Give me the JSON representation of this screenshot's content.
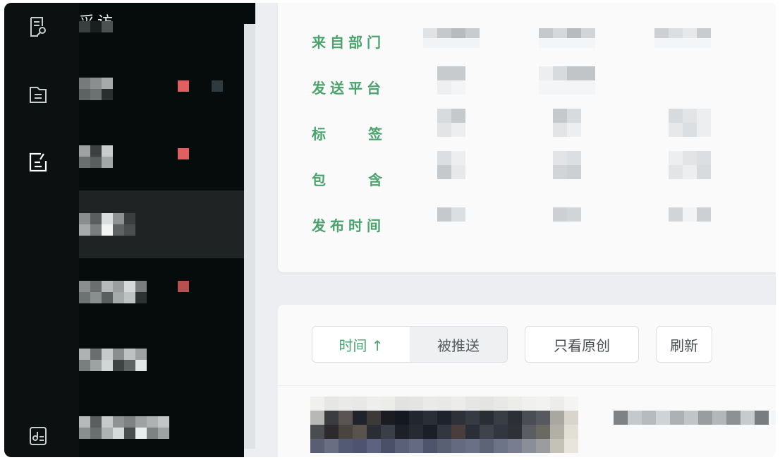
{
  "sidebar": {
    "section_title": "采访",
    "rail_icons": [
      "interview-icon",
      "folder-icon",
      "edit-icon",
      "note-icon"
    ]
  },
  "filters": {
    "labels": {
      "from_department": "来自部门",
      "send_platform": "发送平台",
      "tag_chars": [
        "标",
        "签"
      ],
      "contains_chars": [
        "包",
        "含"
      ],
      "publish_time": "发布时间"
    }
  },
  "toolbar": {
    "sort_time": "时间 ↑",
    "pushed": "被推送",
    "original_only": "只看原创",
    "refresh": "刷新"
  },
  "colors": {
    "accent_green": "#4aa36d",
    "badge_red": "#e06060",
    "sidebar_bg": "#060b0b",
    "active_item_bg": "#1f2324"
  }
}
